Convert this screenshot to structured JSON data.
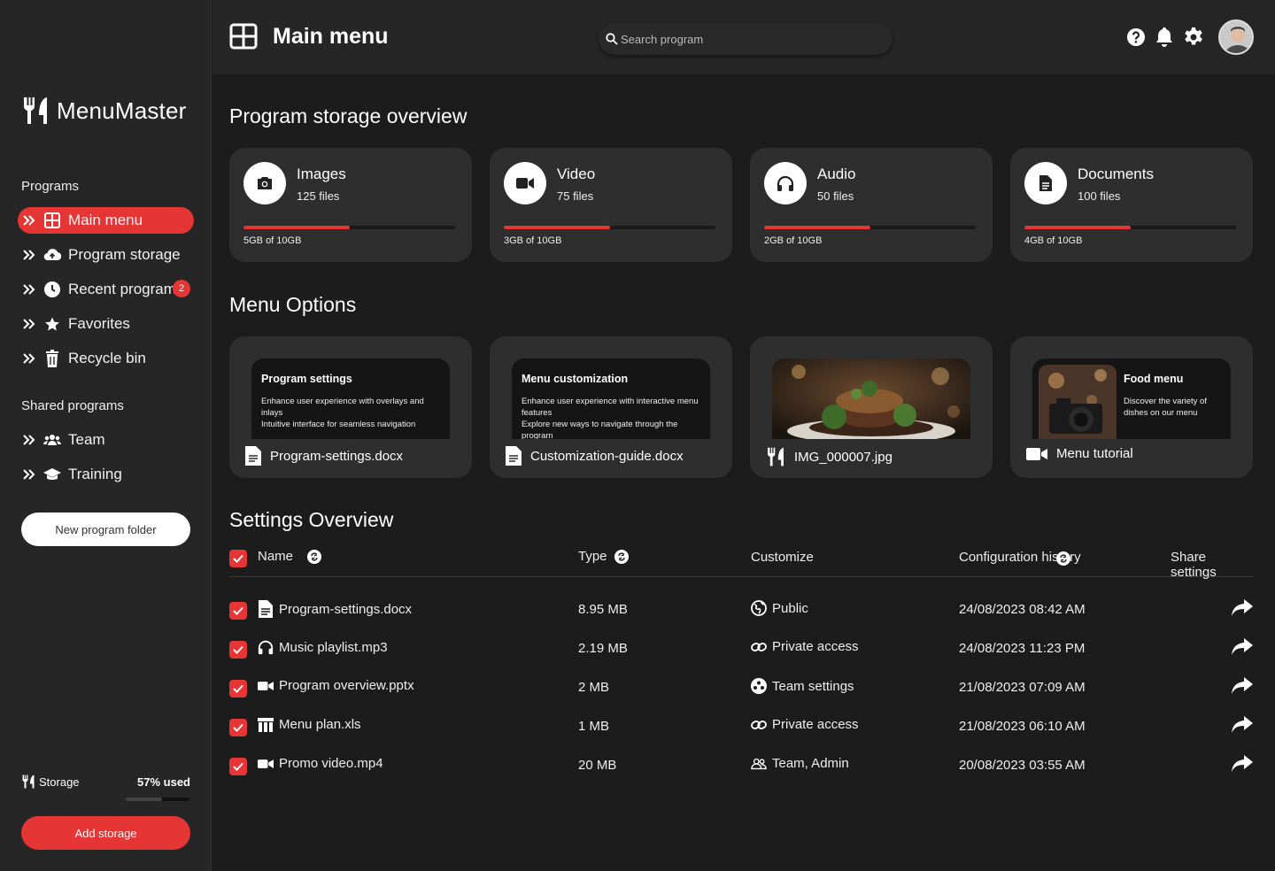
{
  "brand": {
    "name": "MenuMaster"
  },
  "sidebar": {
    "programs_title": "Programs",
    "programs": [
      {
        "label": "Main menu",
        "icon": "grid-icon",
        "active": true
      },
      {
        "label": "Program storage",
        "icon": "cloud-upload-icon"
      },
      {
        "label": "Recent programs",
        "icon": "clock-icon",
        "badge": "2"
      },
      {
        "label": "Favorites",
        "icon": "star-icon"
      },
      {
        "label": "Recycle bin",
        "icon": "trash-icon"
      }
    ],
    "shared_title": "Shared programs",
    "shared": [
      {
        "label": "Team",
        "icon": "users-icon"
      },
      {
        "label": "Training",
        "icon": "graduation-cap-icon"
      }
    ],
    "new_folder_label": "New program folder",
    "storage_label": "Storage",
    "storage_used_label": "57% used",
    "storage_used_fraction": 0.57,
    "add_storage_label": "Add storage"
  },
  "header": {
    "title": "Main menu",
    "search_placeholder": "Search program",
    "icons": [
      "help-icon",
      "bell-icon",
      "gear-icon"
    ]
  },
  "storage_overview": {
    "title": "Program storage overview",
    "cards": [
      {
        "name": "Images",
        "count": "125 files",
        "used": "5GB of 10GB",
        "fraction": 0.5,
        "icon": "camera-icon"
      },
      {
        "name": "Video",
        "count": "75 files",
        "used": "3GB of 10GB",
        "fraction": 0.5,
        "icon": "video-icon"
      },
      {
        "name": "Audio",
        "count": "50 files",
        "used": "2GB of 10GB",
        "fraction": 0.5,
        "icon": "headphones-icon"
      },
      {
        "name": "Documents",
        "count": "100 files",
        "used": "4GB of 10GB",
        "fraction": 0.5,
        "icon": "document-icon"
      }
    ]
  },
  "menu_options": {
    "title": "Menu Options",
    "cards": [
      {
        "preview_title": "Program settings",
        "preview_desc": "Enhance user experience with overlays and inlays\nIntuitive interface for seamless navigation",
        "file": "Program-settings.docx",
        "icon": "document-icon"
      },
      {
        "preview_title": "Menu customization",
        "preview_desc": "Enhance user experience with interactive menu features\nExplore new ways to navigate through the program",
        "file": "Customization-guide.docx",
        "icon": "document-icon"
      },
      {
        "preview_title": "",
        "file": "IMG_000007.jpg",
        "icon": "utensils-icon"
      },
      {
        "preview_title": "Food menu",
        "preview_desc": "Discover the variety of dishes on our menu",
        "file": "Menu tutorial",
        "icon": "video-icon"
      }
    ]
  },
  "settings_overview": {
    "title": "Settings Overview",
    "columns": {
      "name": "Name",
      "type": "Type",
      "customize": "Customize",
      "history": "Configuration history",
      "share": "Share settings"
    },
    "rows": [
      {
        "name": "Program-settings.docx",
        "file_icon": "document-icon",
        "size": "8.95 MB",
        "customize": "Public",
        "customize_icon": "globe-icon",
        "date": "24/08/2023 08:42 AM"
      },
      {
        "name": "Music playlist.mp3",
        "file_icon": "headphones-icon",
        "size": "2.19 MB",
        "customize": "Private access",
        "customize_icon": "link-icon",
        "date": "24/08/2023 11:23 PM"
      },
      {
        "name": "Program overview.pptx",
        "file_icon": "video-icon",
        "size": "2 MB",
        "customize": "Team settings",
        "customize_icon": "team-icon",
        "date": "21/08/2023 07:09 AM"
      },
      {
        "name": "Menu plan.xls",
        "file_icon": "table-icon",
        "size": "1 MB",
        "customize": "Private access",
        "customize_icon": "link-icon",
        "date": "21/08/2023 06:10 AM"
      },
      {
        "name": "Promo video.mp4",
        "file_icon": "video-icon",
        "size": "20 MB",
        "customize": "Team, Admin",
        "customize_icon": "users-icon",
        "date": "20/08/2023 03:55 AM"
      }
    ]
  },
  "colors": {
    "accent": "#e63535",
    "background": "#1c1c1c",
    "panel": "#262626",
    "card": "#2e2e2e"
  }
}
